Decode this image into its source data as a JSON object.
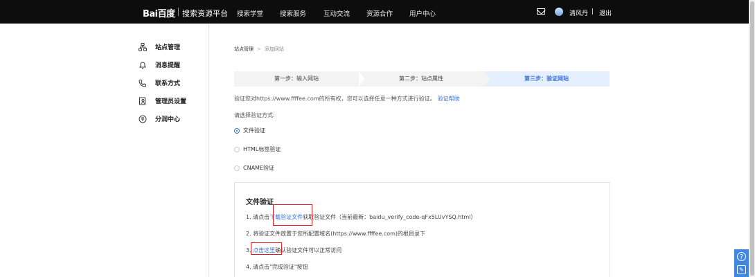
{
  "header": {
    "logo_text": "Bai百度",
    "platform": "搜索资源平台",
    "nav": [
      "搜索学堂",
      "搜索服务",
      "互动交流",
      "资源合作",
      "用户中心"
    ],
    "username": "清风丹",
    "separator": "|",
    "logout": "退出",
    "mail_icon": "mail-icon",
    "avatar_icon": "avatar"
  },
  "sidebar": {
    "items": [
      {
        "label": "站点管理",
        "icon": "sitemap-icon"
      },
      {
        "label": "消息提醒",
        "icon": "bell-icon"
      },
      {
        "label": "联系方式",
        "icon": "phone-icon"
      },
      {
        "label": "管理员设置",
        "icon": "admin-icon"
      },
      {
        "label": "分润中心",
        "icon": "coin-icon"
      }
    ]
  },
  "breadcrumb": {
    "root": "站点管理",
    "sep": ">",
    "current": "添加网站"
  },
  "steps": [
    {
      "label": "第一步：输入网站"
    },
    {
      "label": "第二步：站点属性"
    },
    {
      "label": "第三步：验证网站",
      "active": true
    }
  ],
  "verify_text": "验证您对https://www.ffffee.com的所有权，您可以选择任意一种方式进行验证。",
  "verify_help": "验证帮助",
  "choose_label": "请选择验证方式:",
  "methods": [
    {
      "label": "文件验证",
      "selected": true
    },
    {
      "label": "HTML标签验证",
      "selected": false
    },
    {
      "label": "CNAME验证",
      "selected": false
    }
  ],
  "file_verify": {
    "title": "文件验证",
    "step1_pre": "1.  请点击",
    "step1_link": "下载验证文件",
    "step1_post": "获取验证文件（当前最新：baidu_verify_code-qFx5LUvYSQ.html）",
    "step2": "2.  将验证文件放置于您所配置域名(https://www.ffffee.com)的根目录下",
    "step3_pre": "3.  ",
    "step3_link": "点击这里",
    "step3_post": "确认验证文件可以正常访问",
    "step4": "4.  请点击\"完成验证\"按钮"
  },
  "float_buttons": [
    "help-icon",
    "feedback-icon"
  ],
  "colors": {
    "accent": "#3a6fd8",
    "highlight": "#e02020",
    "topbar": "#0d0d0d"
  }
}
